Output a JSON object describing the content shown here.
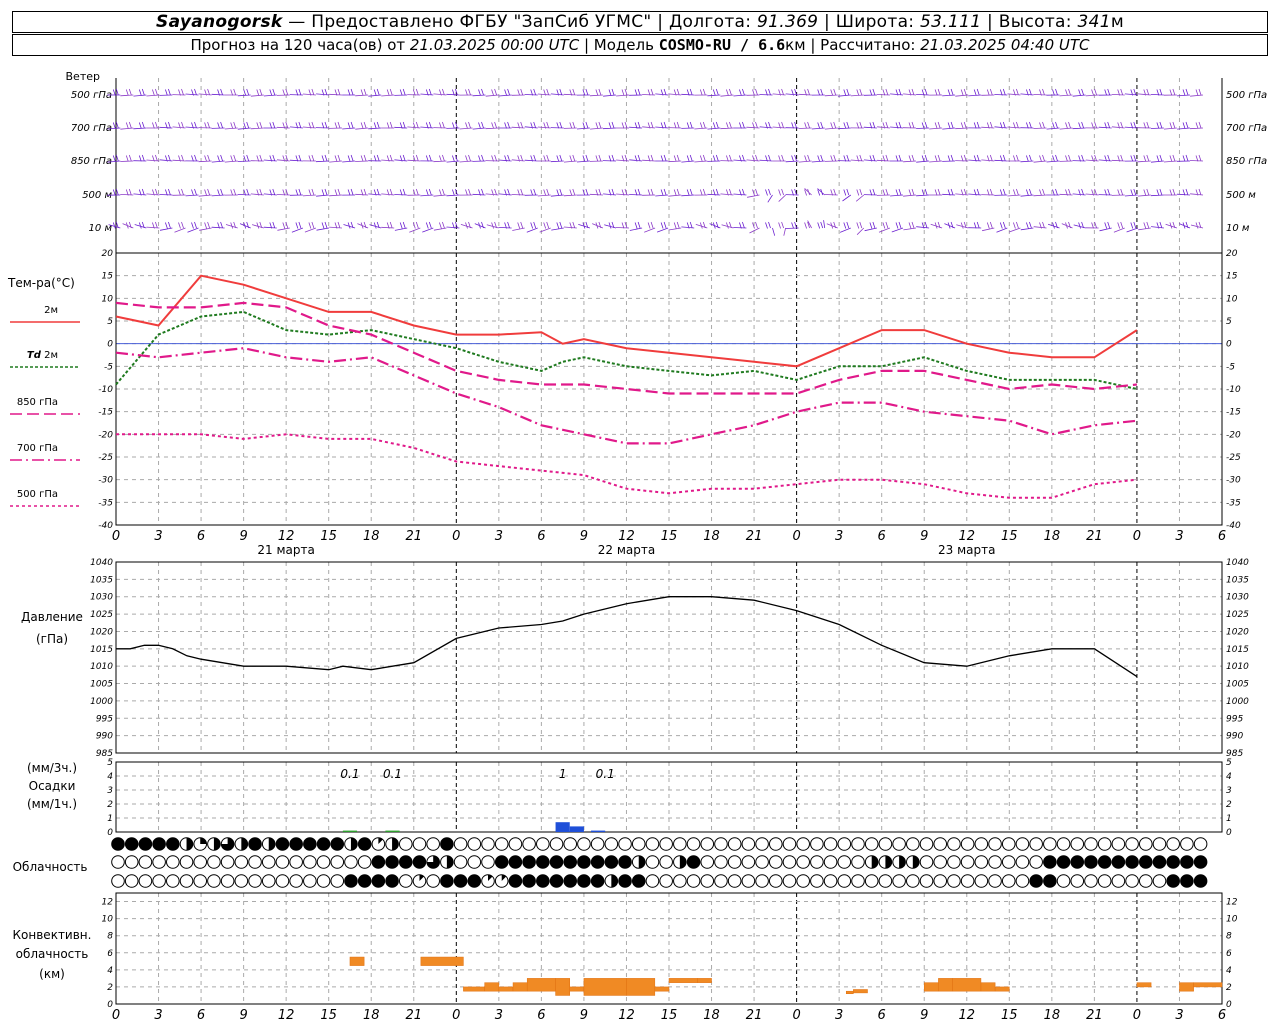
{
  "header": {
    "station": "Sayanogorsk",
    "dash": " — ",
    "provided": "Предоставлено ФГБУ \"ЗапСиб УГМС\"",
    "lon_label": "Долгота:",
    "lon": "91.369",
    "lat_label": "Широта:",
    "lat": "53.111",
    "alt_label": "Высота:",
    "alt": "341",
    "alt_unit": "м",
    "sep": " | "
  },
  "subheader": {
    "forecast_prefix": "Прогноз на 120 часа(ов) от",
    "forecast_time": "21.03.2025 00:00 UTC",
    "model_label": "Модель",
    "model": "COSMO-RU / 6.6",
    "model_unit": "км",
    "calc_label": "Рассчитано:",
    "calc_time": "21.03.2025 04:40 UTC",
    "sep": " | "
  },
  "wind": {
    "title": "Ветер",
    "levels": [
      "500 гПа",
      "700 гПа",
      "850 гПа",
      "500 м",
      "10 м"
    ],
    "colors": [
      "#6a1fd0",
      "#8b3bc8"
    ]
  },
  "temperature": {
    "title": "Тем-ра(°С)",
    "legend": [
      {
        "label": "2м",
        "italic_prefix": "",
        "color": "#f03c3c",
        "dash": ""
      },
      {
        "label": "2м",
        "italic_prefix": "Td",
        "color": "#1f7a1f",
        "dash": "3,2"
      },
      {
        "label": "850 гПа",
        "italic_prefix": "",
        "color": "#e0198a",
        "dash": "12,5"
      },
      {
        "label": "700 гПа",
        "italic_prefix": "",
        "color": "#e0198a",
        "dash": "12,4,2,4"
      },
      {
        "label": "500 гПа",
        "italic_prefix": "",
        "color": "#e0198a",
        "dash": "3,3"
      }
    ]
  },
  "x_axis": {
    "ticks": [
      "0",
      "3",
      "6",
      "9",
      "12",
      "15",
      "18",
      "21",
      "0",
      "3",
      "6",
      "9",
      "12",
      "15",
      "18",
      "21",
      "0",
      "3",
      "6",
      "9",
      "12",
      "15",
      "18",
      "21",
      "0",
      "3",
      "6"
    ],
    "days": [
      "21 марта",
      "22 марта",
      "23 марта"
    ]
  },
  "pressure": {
    "title": "Давление",
    "unit": "(гПа)"
  },
  "precip": {
    "unit1": "(мм/3ч.)",
    "title": "Осадки",
    "unit2": "(мм/1ч.)",
    "annotations": [
      "0.1",
      "0.1",
      "1",
      "0.1"
    ]
  },
  "clouds": {
    "title": "Облачность"
  },
  "convective": {
    "title1": "Конвективн.",
    "title2": "облачность",
    "unit": "(км)"
  },
  "chart_data": [
    {
      "type": "line",
      "name": "temperature",
      "x_unit": "hours from 21.03.2025 00:00 UTC",
      "ylim": [
        -40,
        20
      ],
      "yticks": [
        20,
        15,
        10,
        5,
        0,
        -5,
        -10,
        -15,
        -20,
        -25,
        -30,
        -35,
        -40
      ],
      "grid": true,
      "series": [
        {
          "name": "2м",
          "color": "#f03c3c",
          "x": [
            0,
            3,
            6,
            9,
            12,
            15,
            18,
            21,
            24,
            27,
            30,
            31.5,
            33,
            36,
            39,
            42,
            45,
            48,
            51,
            54,
            57,
            60,
            63,
            66,
            69,
            72
          ],
          "y": [
            6,
            4,
            15,
            13,
            10,
            7,
            7,
            4,
            2,
            2,
            2.5,
            0,
            1,
            -1,
            -2,
            -3,
            -4,
            -5,
            -1,
            3,
            3,
            0,
            -2,
            -3,
            -3,
            3
          ]
        },
        {
          "name": "Td 2м",
          "color": "#1f7a1f",
          "x": [
            0,
            3,
            6,
            9,
            12,
            15,
            18,
            21,
            24,
            27,
            30,
            31.5,
            33,
            36,
            39,
            42,
            45,
            48,
            51,
            54,
            57,
            60,
            63,
            66,
            69,
            72
          ],
          "y": [
            -9,
            2,
            6,
            7,
            3,
            2,
            3,
            1,
            -1,
            -4,
            -6,
            -4,
            -3,
            -5,
            -6,
            -7,
            -6,
            -8,
            -5,
            -5,
            -3,
            -6,
            -8,
            -8,
            -8,
            -10
          ]
        },
        {
          "name": "850 гПа",
          "color": "#e0198a",
          "x": [
            0,
            3,
            6,
            9,
            12,
            15,
            18,
            21,
            24,
            27,
            30,
            33,
            36,
            39,
            42,
            45,
            48,
            51,
            54,
            57,
            60,
            63,
            66,
            69,
            72
          ],
          "y": [
            9,
            8,
            8,
            9,
            8,
            4,
            2,
            -2,
            -6,
            -8,
            -9,
            -9,
            -10,
            -11,
            -11,
            -11,
            -11,
            -8,
            -6,
            -6,
            -8,
            -10,
            -9,
            -10,
            -9
          ]
        },
        {
          "name": "700 гПа",
          "color": "#e0198a",
          "x": [
            0,
            3,
            6,
            9,
            12,
            15,
            18,
            21,
            24,
            27,
            30,
            33,
            36,
            39,
            42,
            45,
            48,
            51,
            54,
            57,
            60,
            63,
            66,
            69,
            72
          ],
          "y": [
            -2,
            -3,
            -2,
            -1,
            -3,
            -4,
            -3,
            -7,
            -11,
            -14,
            -18,
            -20,
            -22,
            -22,
            -20,
            -18,
            -15,
            -13,
            -13,
            -15,
            -16,
            -17,
            -20,
            -18,
            -17
          ]
        },
        {
          "name": "500 гПа",
          "color": "#e0198a",
          "x": [
            0,
            3,
            6,
            9,
            12,
            15,
            18,
            21,
            24,
            27,
            30,
            33,
            36,
            39,
            42,
            45,
            48,
            51,
            54,
            57,
            60,
            63,
            66,
            69,
            72
          ],
          "y": [
            -20,
            -20,
            -20,
            -21,
            -20,
            -21,
            -21,
            -23,
            -26,
            -27,
            -28,
            -29,
            -32,
            -33,
            -32,
            -32,
            -31,
            -30,
            -30,
            -31,
            -33,
            -34,
            -34,
            -31,
            -30
          ]
        }
      ]
    },
    {
      "type": "line",
      "name": "pressure",
      "x_unit": "hours from 21.03.2025 00:00 UTC",
      "ylim": [
        985,
        1040
      ],
      "yticks": [
        1040,
        1035,
        1030,
        1025,
        1020,
        1015,
        1010,
        1005,
        1000,
        995,
        990,
        985
      ],
      "grid": true,
      "series": [
        {
          "name": "Давление",
          "color": "#000000",
          "x": [
            0,
            1,
            2,
            3,
            4,
            5,
            6,
            9,
            12,
            15,
            16,
            18,
            21,
            24,
            27,
            30,
            31.5,
            33,
            36,
            39,
            42,
            45,
            48,
            51,
            54,
            57,
            60,
            63,
            66,
            69,
            72
          ],
          "y": [
            1015,
            1015,
            1016,
            1016,
            1015,
            1013,
            1012,
            1010,
            1010,
            1009,
            1010,
            1009,
            1011,
            1018,
            1021,
            1022,
            1023,
            1025,
            1028,
            1030,
            1030,
            1029,
            1026,
            1022,
            1016,
            1011,
            1010,
            1013,
            1015,
            1015,
            1007
          ]
        }
      ]
    },
    {
      "type": "bar",
      "name": "precipitation",
      "x_unit": "hours from 21.03.2025 00:00 UTC",
      "ylim": [
        0,
        5
      ],
      "yticks": [
        5,
        4,
        3,
        2,
        1,
        0
      ],
      "series": [
        {
          "name": "осадки",
          "values": [
            {
              "x": 16.5,
              "y": 0.1,
              "color": "#2ea02e"
            },
            {
              "x": 19.5,
              "y": 0.1,
              "color": "#2ea02e"
            },
            {
              "x": 31.5,
              "y": 0.7,
              "color": "#1f4fd8"
            },
            {
              "x": 32.5,
              "y": 0.4,
              "color": "#1f4fd8"
            },
            {
              "x": 34,
              "y": 0.1,
              "color": "#1f4fd8"
            }
          ]
        }
      ]
    },
    {
      "type": "table",
      "name": "cloudiness",
      "rows": 3,
      "columns": 81,
      "encoding": "cloud cover in octas (0 = clear circle, 8 = filled circle)",
      "cells": [
        "88888424648488888481400080000000000000000000000000000000000000000000000000000000",
        "00000000000000000008888640008888888888400480000000000004444000000000888888888888",
        "00000000000000000888801088811888888848800000000000000000000000000008800000000888"
      ]
    },
    {
      "type": "bar",
      "name": "convective_cloud",
      "x_unit": "hours from 21.03.2025 00:00 UTC",
      "ylim": [
        0,
        13
      ],
      "yticks": [
        12,
        10,
        8,
        6,
        4,
        2,
        0
      ],
      "series": [
        {
          "name": "облачность",
          "color": "#f08a24",
          "values": [
            {
              "x0": 16.5,
              "x1": 17.5,
              "y0": 4.5,
              "y1": 5.5
            },
            {
              "x0": 21.5,
              "x1": 24.5,
              "y0": 4.5,
              "y1": 5.5
            },
            {
              "x0": 24.5,
              "x1": 26,
              "y0": 1.5,
              "y1": 2
            },
            {
              "x0": 26,
              "x1": 27,
              "y0": 1.5,
              "y1": 2.5
            },
            {
              "x0": 27,
              "x1": 28,
              "y0": 1.5,
              "y1": 2
            },
            {
              "x0": 28,
              "x1": 29,
              "y0": 1.5,
              "y1": 2.5
            },
            {
              "x0": 29,
              "x1": 31,
              "y0": 1.5,
              "y1": 3
            },
            {
              "x0": 31,
              "x1": 32,
              "y0": 1,
              "y1": 3
            },
            {
              "x0": 32,
              "x1": 33,
              "y0": 1.5,
              "y1": 2
            },
            {
              "x0": 33,
              "x1": 36,
              "y0": 1,
              "y1": 3
            },
            {
              "x0": 36,
              "x1": 38,
              "y0": 1,
              "y1": 3
            },
            {
              "x0": 38,
              "x1": 39,
              "y0": 1.5,
              "y1": 2
            },
            {
              "x0": 39,
              "x1": 41,
              "y0": 2.5,
              "y1": 3
            },
            {
              "x0": 41,
              "x1": 42,
              "y0": 2.5,
              "y1": 3
            },
            {
              "x0": 51.5,
              "x1": 52,
              "y0": 1.2,
              "y1": 1.5
            },
            {
              "x0": 52,
              "x1": 53,
              "y0": 1.3,
              "y1": 1.7
            },
            {
              "x0": 57,
              "x1": 58,
              "y0": 1.5,
              "y1": 2.5
            },
            {
              "x0": 58,
              "x1": 59,
              "y0": 1.5,
              "y1": 3
            },
            {
              "x0": 59,
              "x1": 61,
              "y0": 1.5,
              "y1": 3
            },
            {
              "x0": 61,
              "x1": 62,
              "y0": 1.5,
              "y1": 2.5
            },
            {
              "x0": 62,
              "x1": 63,
              "y0": 1.5,
              "y1": 2
            },
            {
              "x0": 72,
              "x1": 73,
              "y0": 2,
              "y1": 2.5
            },
            {
              "x0": 75,
              "x1": 76,
              "y0": 1.5,
              "y1": 2.5
            },
            {
              "x0": 76,
              "x1": 78,
              "y0": 2,
              "y1": 2.5
            }
          ]
        }
      ]
    }
  ]
}
